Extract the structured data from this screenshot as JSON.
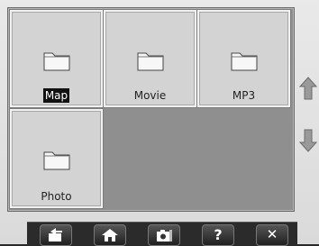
{
  "tiles": [
    {
      "label": "Map",
      "selected": true
    },
    {
      "label": "Movie",
      "selected": false
    },
    {
      "label": "MP3",
      "selected": false
    },
    {
      "label": "Photo",
      "selected": false
    }
  ],
  "toolbar": {
    "buttons": [
      "back-icon",
      "home-icon",
      "camera-icon",
      "help-icon",
      "close-icon"
    ],
    "help_glyph": "?",
    "close_glyph": "✕"
  },
  "side_arrows": [
    "up-arrow-icon",
    "down-arrow-icon"
  ]
}
